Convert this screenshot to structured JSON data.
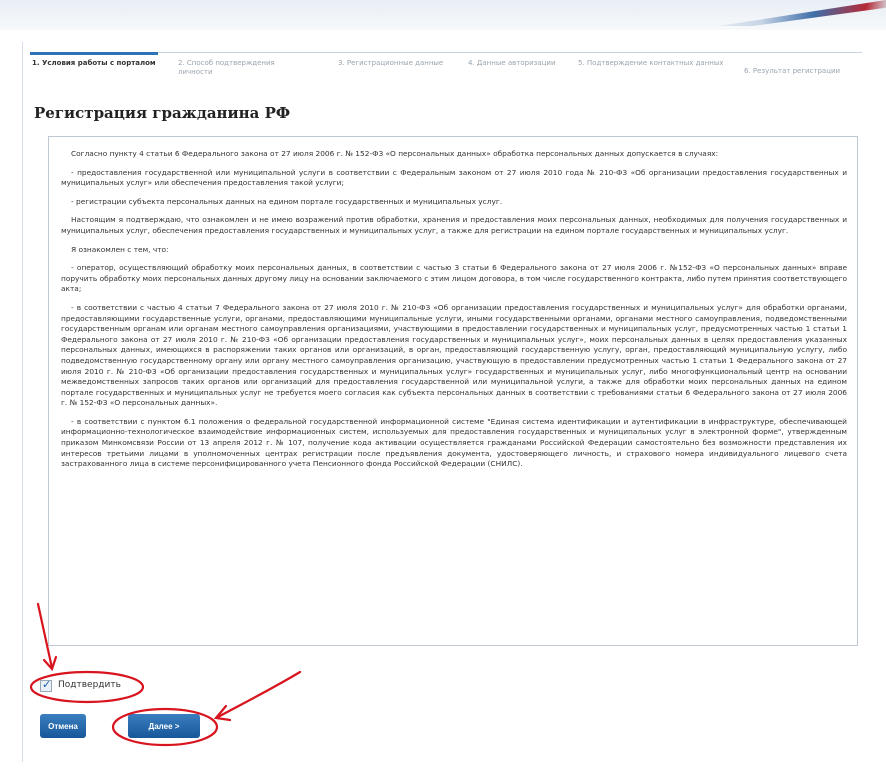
{
  "steps": [
    {
      "label": "1. Условия работы с порталом",
      "active": true
    },
    {
      "label": "2. Способ подтверждения личности",
      "active": false
    },
    {
      "label": "3. Регистрационные данные",
      "active": false
    },
    {
      "label": "4. Данные авторизации",
      "active": false
    },
    {
      "label": "5. Подтверждение контактных данных",
      "active": false
    },
    {
      "label": "6. Результат регистрации",
      "active": false
    }
  ],
  "page_title": "Регистрация гражданина РФ",
  "agreement": [
    "Согласно пункту 4 статьи 6 Федерального закона от 27 июля 2006 г. № 152-ФЗ «О персональных данных» обработка персональных данных допускается в случаях:",
    "- предоставления государственной или муниципальной услуги в соответствии с Федеральным законом от 27 июля 2010 года № 210-ФЗ «Об организации предоставления государственных и муниципальных услуг» или обеспечения предоставления такой услуги;",
    "- регистрации субъекта персональных данных на едином портале государственных и муниципальных услуг.",
    "Настоящим я подтверждаю, что ознакомлен и не имею возражений против обработки, хранения и предоставления моих персональных данных, необходимых для получения государственных и муниципальных услуг, обеспечения предоставления государственных и муниципальных услуг, а также для регистрации на едином портале государственных и муниципальных услуг.",
    "Я ознакомлен с тем, что:",
    "- оператор, осуществляющий обработку моих персональных данных, в соответствии с частью 3 статьи 6 Федерального закона от 27 июля 2006 г. №152-ФЗ «О персональных данных» вправе поручить обработку моих персональных данных другому лицу на основании заключаемого с этим лицом договора, в том числе государственного контракта, либо путем принятия соответствующего акта;",
    "- в соответствии с частью 4 статьи 7 Федерального закона от 27 июля 2010 г. № 210-ФЗ «Об организации предоставления государственных и муниципальных услуг» для обработки органами, предоставляющими государственные услуги, органами, предоставляющими муниципальные услуги, иными государственными органами, органами местного самоуправления, подведомственными государственным органам или органам местного самоуправления организациями, участвующими в предоставлении государственных и муниципальных услуг, предусмотренных частью 1 статьи 1 Федерального закона от 27 июля 2010 г. № 210-ФЗ «Об организации предоставления государственных и муниципальных услуг», моих персональных данных в целях предоставления указанных персональных данных, имеющихся в распоряжении таких органов или организаций, в орган, предоставляющий государственную услугу, орган, предоставляющий муниципальную услугу, либо подведомственную государственному органу или органу местного самоуправления организацию, участвующую в предоставлении предусмотренных частью 1 статьи 1 Федерального закона от 27 июля 2010 г. № 210-ФЗ «Об организации предоставления государственных и муниципальных услуг» государственных и муниципальных услуг, либо многофункциональный центр на основании межведомственных запросов таких органов или организаций для предоставления государственной или муниципальной услуги, а также для обработки моих персональных данных на едином портале государственных и муниципальных услуг не требуется моего согласия как субъекта персональных данных в соответствии с требованиями статьи 6 Федерального закона от 27 июля 2006 г. № 152-ФЗ «О персональных данных».",
    "- в соответствии с пунктом 6.1 положения о федеральной государственной информационной системе \"Единая система идентификации и аутентификации в инфраструктуре, обеспечивающей информационно-технологическое взаимодействие информационных систем, используемых для предоставления государственных и муниципальных услуг в электронной форме\", утвержденным приказом Минкомсвязи России от 13 апреля 2012 г. № 107, получение кода активации осуществляется гражданами Российской Федерации самостоятельно без возможности представления их интересов третьими лицами в уполномоченных центрах регистрации после предъявления документа, удостоверяющего личность, и страхового номера индивидуального лицевого счета застрахованного лица в системе персонифицированного учета Пенсионного фонда Российской Федерации (СНИЛС)."
  ],
  "confirm_label": "Подтвердить",
  "buttons": {
    "cancel": "Отмена",
    "next": "Далее >"
  },
  "colors": {
    "accent": "#2d73b5",
    "annotation": "#d8141e"
  }
}
